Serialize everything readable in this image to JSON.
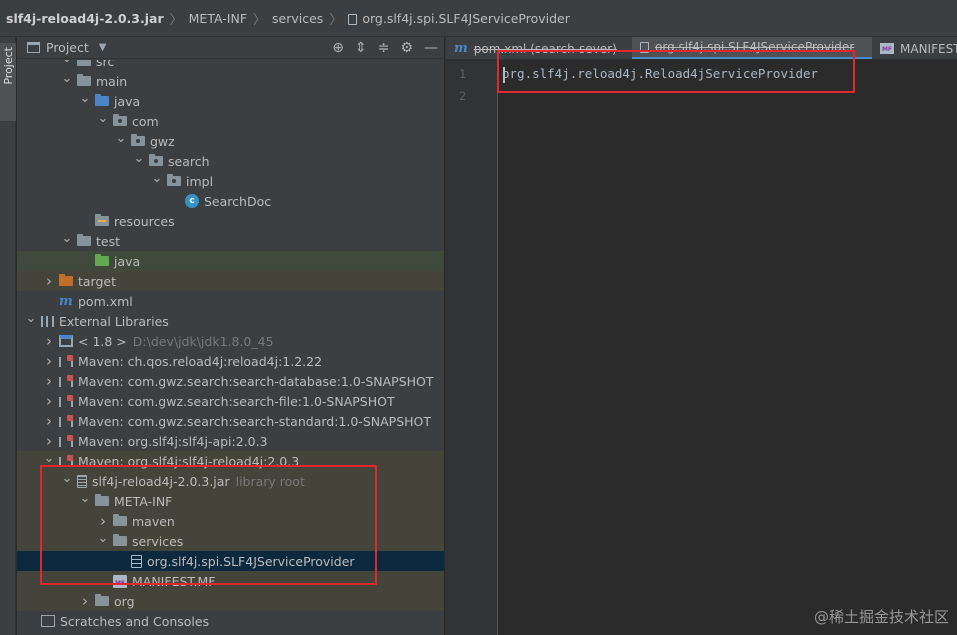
{
  "breadcrumb": {
    "items": [
      "slf4j-reload4j-2.0.3.jar",
      "META-INF",
      "services",
      "org.slf4j.spi.SLF4JServiceProvider"
    ]
  },
  "stripe": {
    "label": "Project"
  },
  "project_panel": {
    "title": "Project",
    "tools": [
      "target-icon",
      "expand-all-icon",
      "collapse-all-icon",
      "gear-icon",
      "minimize-icon"
    ]
  },
  "tree": [
    {
      "label": "src",
      "icon": "folder",
      "arrow": "down"
    },
    {
      "label": "main",
      "icon": "folder",
      "arrow": "down"
    },
    {
      "label": "java",
      "icon": "folder-blue",
      "arrow": "down"
    },
    {
      "label": "com",
      "icon": "package",
      "arrow": "down"
    },
    {
      "label": "gwz",
      "icon": "package",
      "arrow": "down"
    },
    {
      "label": "search",
      "icon": "package",
      "arrow": "down"
    },
    {
      "label": "impl",
      "icon": "package",
      "arrow": "down"
    },
    {
      "label": "SearchDoc",
      "icon": "class",
      "arrow": ""
    },
    {
      "label": "resources",
      "icon": "folder-resources",
      "arrow": ""
    },
    {
      "label": "test",
      "icon": "folder",
      "arrow": "down"
    },
    {
      "label": "java",
      "icon": "folder-green",
      "arrow": ""
    },
    {
      "label": "target",
      "icon": "folder-orange",
      "arrow": "right"
    },
    {
      "label": "pom.xml",
      "icon": "maven",
      "arrow": ""
    },
    {
      "label": "External Libraries",
      "icon": "libraries",
      "arrow": "down"
    },
    {
      "label": "< 1.8 >",
      "hint": "D:\\dev\\jdk\\jdk1.8.0_45",
      "icon": "jdk",
      "arrow": "right"
    },
    {
      "label": "Maven: ch.qos.reload4j:reload4j:1.2.22",
      "icon": "maven-library",
      "arrow": "right"
    },
    {
      "label": "Maven: com.gwz.search:search-database:1.0-SNAPSHOT",
      "icon": "maven-library",
      "arrow": "right"
    },
    {
      "label": "Maven: com.gwz.search:search-file:1.0-SNAPSHOT",
      "icon": "maven-library",
      "arrow": "right"
    },
    {
      "label": "Maven: com.gwz.search:search-standard:1.0-SNAPSHOT",
      "icon": "maven-library",
      "arrow": "right"
    },
    {
      "label": "Maven: org.slf4j:slf4j-api:2.0.3",
      "icon": "maven-library",
      "arrow": "right"
    },
    {
      "label": "Maven: org.slf4j:slf4j-reload4j:2.0.3",
      "icon": "maven-library",
      "arrow": "down"
    },
    {
      "label": "slf4j-reload4j-2.0.3.jar",
      "hint": "library root",
      "icon": "jar",
      "arrow": "down"
    },
    {
      "label": "META-INF",
      "icon": "folder",
      "arrow": "down"
    },
    {
      "label": "maven",
      "icon": "folder",
      "arrow": "right"
    },
    {
      "label": "services",
      "icon": "folder",
      "arrow": "down"
    },
    {
      "label": "org.slf4j.spi.SLF4JServiceProvider",
      "icon": "text-file",
      "arrow": ""
    },
    {
      "label": "MANIFEST.MF",
      "icon": "manifest",
      "arrow": ""
    },
    {
      "label": "org",
      "icon": "folder",
      "arrow": "right"
    },
    {
      "label": "Scratches and Consoles",
      "icon": "console",
      "arrow": ""
    }
  ],
  "editor": {
    "tabs": [
      {
        "label": "pom.xml (search-sever)",
        "icon": "maven",
        "active": false
      },
      {
        "label": "org.slf4j.spi.SLF4JServiceProvider",
        "icon": "text-file",
        "active": true
      },
      {
        "label": "MANIFEST.MF",
        "icon": "manifest",
        "active": false
      }
    ],
    "line_numbers": [
      "1",
      "2"
    ],
    "lines": [
      "org.slf4j.reload4j.Reload4jServiceProvider",
      ""
    ]
  },
  "watermark": "@稀土掘金技术社区",
  "colors": {
    "annotation": "#e0282e",
    "selection": "#0d293e",
    "test_tint": "#3f4a3c",
    "library_tint": "#45443a"
  }
}
